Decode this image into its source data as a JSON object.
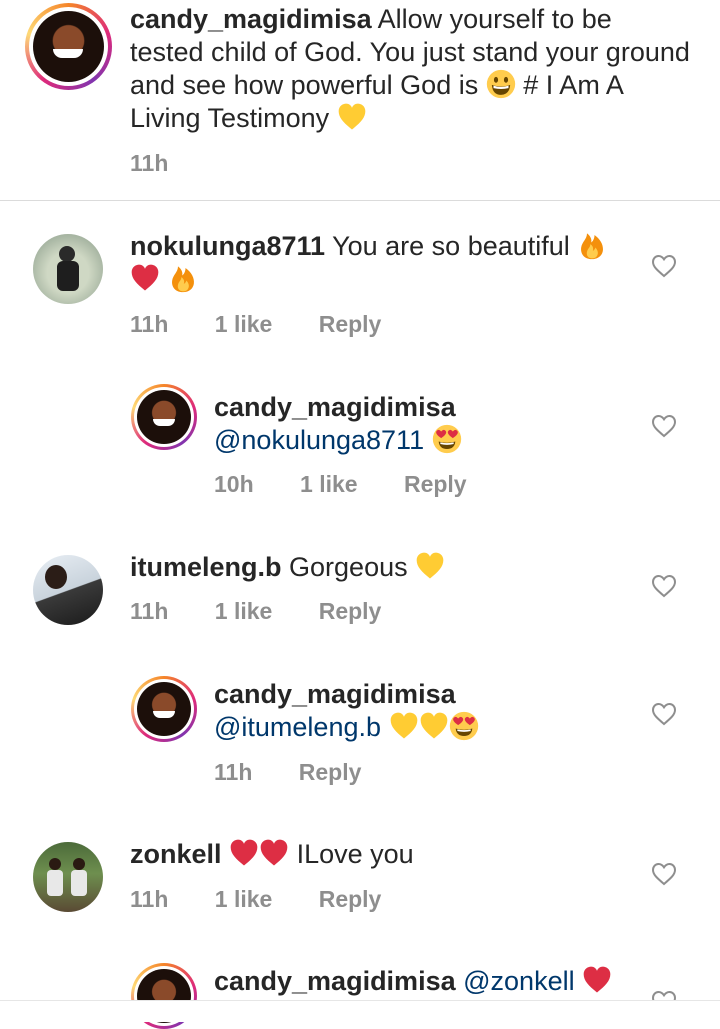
{
  "caption": {
    "username": "candy_magidimisa",
    "text": "Allow yourself to be tested child of God. You just stand  your ground and see how powerful God is",
    "text_tail": "#",
    "line4": "I Am  A Living Testimony",
    "time": "11h"
  },
  "comments": [
    {
      "username": "nokulunga8711",
      "text": "You are so beautiful",
      "time": "11h",
      "likes": "1 like",
      "reply": "Reply"
    },
    {
      "username": "candy_magidimisa",
      "mention": "@nokulunga8711",
      "time": "10h",
      "likes": "1 like",
      "reply": "Reply"
    },
    {
      "username": "itumeleng.b",
      "text": "Gorgeous",
      "time": "11h",
      "likes": "1 like",
      "reply": "Reply"
    },
    {
      "username": "candy_magidimisa",
      "mention": "@itumeleng.b",
      "time": "11h",
      "reply": "Reply"
    },
    {
      "username": "zonkell",
      "text": "ILove you",
      "time": "11h",
      "likes": "1 like",
      "reply": "Reply"
    },
    {
      "username": "candy_magidimisa",
      "mention": "@zonkell"
    }
  ],
  "icons": {
    "like": "heart-outline-icon",
    "emojis": [
      "grinning-face",
      "yellow-heart",
      "fire",
      "red-heart",
      "heart-eyes-face"
    ]
  },
  "colors": {
    "text": "#262626",
    "meta": "#8e8e8e",
    "mention": "#00376b",
    "red_heart": "#dd2e44",
    "yellow_heart": "#ffcc33"
  }
}
